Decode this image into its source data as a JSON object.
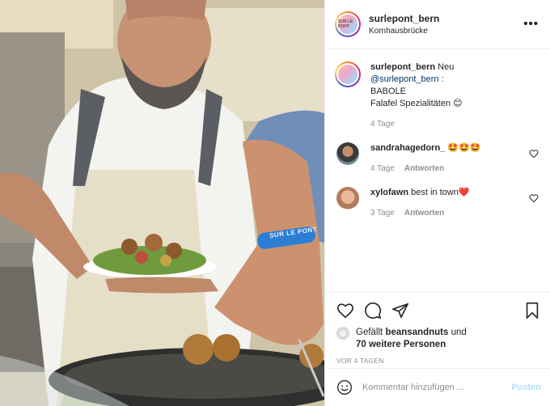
{
  "post": {
    "username": "surlepont_bern",
    "location": "Kornhausbrücke",
    "more_icon": "more-horizontal-icon",
    "avatar_text": "SUR LE PONT"
  },
  "photo": {
    "wristband_text": "SUR LE PONT",
    "subject": "chef-serving-falafel"
  },
  "caption": {
    "username": "surlepont_bern",
    "text_prefix": "Neu",
    "mention": "@surlepont_bern",
    "text_line1_suffix": ":",
    "line2": "BABOLE",
    "line3": "Falafel Spezialitäten 😊",
    "time": "4 Tage"
  },
  "comments": [
    {
      "username": "sandrahagedorn_",
      "text": "🤩🤩🤩",
      "time": "4 Tage",
      "reply": "Antworten"
    },
    {
      "username": "xylofawn",
      "text": "best in town❤️",
      "time": "3 Tage",
      "reply": "Antworten"
    }
  ],
  "likes": {
    "prefix": "Gefällt",
    "user": "beansandnuts",
    "middle": "und",
    "others": "70 weitere Personen"
  },
  "timestamp": "VOR 4 TAGEN",
  "add_comment": {
    "placeholder": "Kommentar hinzufügen ...",
    "post_label": "Posten"
  },
  "colors": {
    "text": "#262626",
    "muted": "#8e8e8e",
    "mention": "#00376b",
    "post_button_disabled": "#b2dffc",
    "divider": "#efefef"
  }
}
